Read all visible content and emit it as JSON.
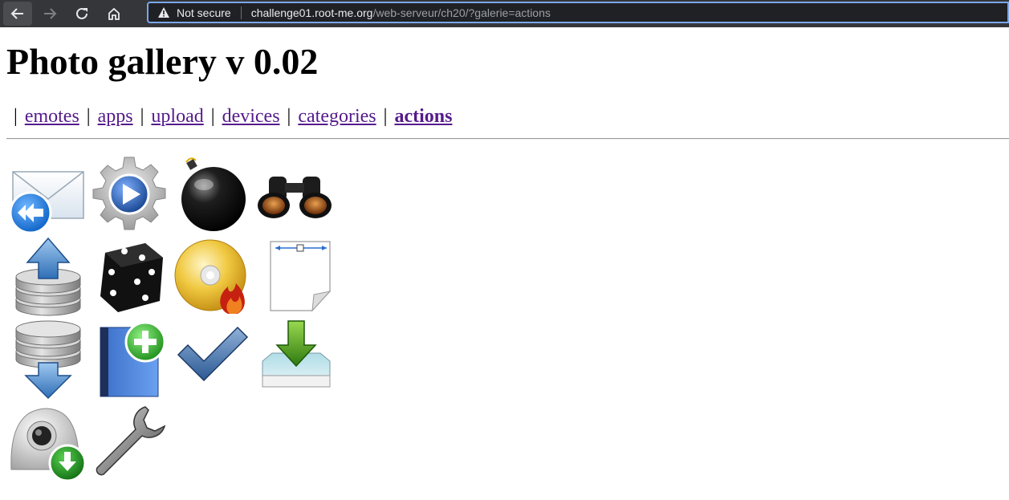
{
  "browser": {
    "security_label": "Not secure",
    "url_host": "challenge01.root-me.org",
    "url_path": "/web-serveur/ch20/?galerie=actions"
  },
  "page": {
    "title": "Photo gallery v 0.02",
    "menu": [
      {
        "label": "emotes"
      },
      {
        "label": "apps"
      },
      {
        "label": "upload"
      },
      {
        "label": "devices"
      },
      {
        "label": "categories"
      },
      {
        "label": "actions",
        "current": true
      }
    ],
    "separator": "|"
  },
  "gallery": {
    "images": [
      {
        "icon": "mail-reply-icon"
      },
      {
        "icon": "gear-play-icon"
      },
      {
        "icon": "bomb-icon"
      },
      {
        "icon": "binoculars-icon"
      },
      {
        "icon": "database-upload-icon"
      },
      {
        "icon": "dice-icon"
      },
      {
        "icon": "disc-burn-icon"
      },
      {
        "icon": "page-resize-icon"
      },
      {
        "icon": "database-download-icon"
      },
      {
        "icon": "book-add-icon"
      },
      {
        "icon": "checkmark-icon"
      },
      {
        "icon": "inbox-download-icon"
      },
      {
        "icon": "webcam-download-icon"
      },
      {
        "icon": "wrench-icon"
      }
    ]
  }
}
